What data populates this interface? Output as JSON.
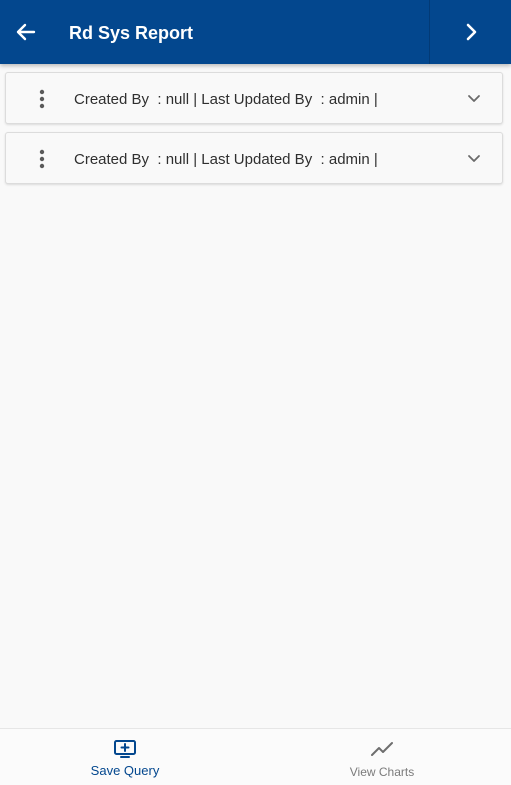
{
  "header": {
    "title": "Rd Sys Report",
    "back_icon": "arrow-left-icon",
    "forward_icon": "chevron-right-icon"
  },
  "records": [
    {
      "text": "Created By  : null | Last Updated By  : admin |"
    },
    {
      "text": "Created By  : null | Last Updated By  : admin |"
    }
  ],
  "bottom_nav": {
    "save_query": {
      "label": "Save Query",
      "icon": "monitor-plus-icon",
      "active": true
    },
    "view_charts": {
      "label": "View Charts",
      "icon": "trend-line-icon",
      "active": false
    }
  },
  "colors": {
    "header_bg": "#03478e",
    "active_tab": "#03478e",
    "inactive_tab": "#7b7b7b",
    "page_bg": "#f9f9f9"
  }
}
